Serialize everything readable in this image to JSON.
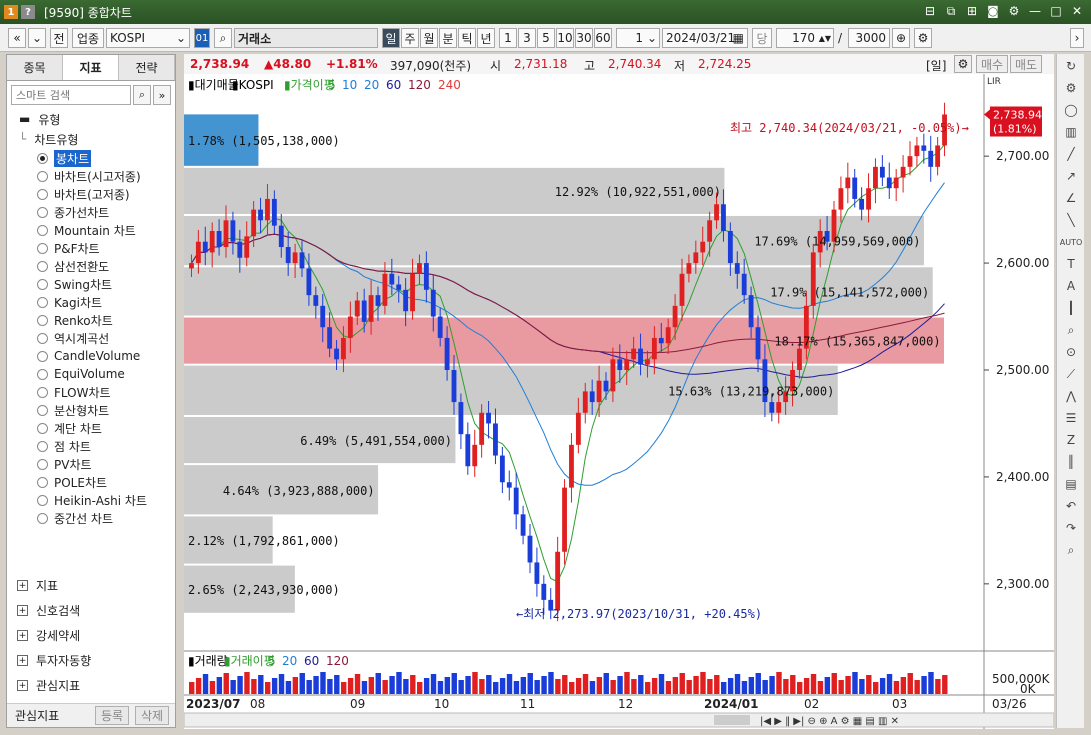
{
  "window": {
    "title": "[9590] 종합차트",
    "icons": [
      "app-icon-1",
      "help-icon"
    ]
  },
  "toolbar": {
    "nav_prev": "«",
    "nav_more": "»",
    "prev_label": "전",
    "sector_label": "업종",
    "symbol": "KOSPI",
    "code_badge": "01",
    "market": "거래소",
    "periods": [
      "일",
      "주",
      "월",
      "분",
      "틱",
      "년"
    ],
    "period_active": "일",
    "minutes": [
      "1",
      "3",
      "5",
      "10",
      "30",
      "60"
    ],
    "interval_value": "1",
    "date": "2024/03/21",
    "cur_label": "당",
    "count": "170",
    "slash": "/",
    "max_count": "3000"
  },
  "quote": {
    "price": "2,738.94",
    "change": "▲48.80",
    "change_pct": "+1.81%",
    "volume": "397,090(천주)",
    "open_label": "시",
    "open": "2,731.18",
    "high_label": "고",
    "high": "2,740.34",
    "low_label": "저",
    "low": "2,724.25",
    "period_badge": "[일]",
    "buy_label": "매수",
    "sell_label": "매도"
  },
  "left_panel": {
    "tabs": [
      "종목",
      "지표",
      "전략"
    ],
    "active_tab": "지표",
    "search_placeholder": "스마트 검색",
    "group_type": "유형",
    "chart_type_header": "차트유형",
    "chart_types": [
      "봉차트",
      "바차트(시고저종)",
      "바차트(고저종)",
      "종가선차트",
      "Mountain 차트",
      "P&F차트",
      "삼선전환도",
      "Swing차트",
      "Kagi차트",
      "Renko차트",
      "역시계곡선",
      "CandleVolume",
      "EquiVolume",
      "FLOW차트",
      "분산형차트",
      "계단 차트",
      "점 차트",
      "PV차트",
      "POLE차트",
      "Heikin-Ashi 차트",
      "중간선 차트"
    ],
    "selected_type": "봉차트",
    "groups": [
      "지표",
      "신호검색",
      "강세약세",
      "투자자동향",
      "관심지표"
    ],
    "favorites_label": "관심지표",
    "register_label": "등록",
    "delete_label": "삭제"
  },
  "chart_data": {
    "type": "candlestick",
    "legend": [
      "대기매물",
      "KOSPI",
      "가격이평",
      "5",
      "10",
      "20",
      "60",
      "120",
      "240"
    ],
    "legend_colors": [
      "#000000",
      "#000000",
      "#2e9e2e",
      "#2e9e2e",
      "#1f7ed8",
      "#1f7ed8",
      "#1a1a9e",
      "#8b1a3a",
      "#e03c3c"
    ],
    "ylim": [
      2240,
      2760
    ],
    "yticks": [
      "2,700.00",
      "2,600.00",
      "2,500.00",
      "2,400.00",
      "2,300.00"
    ],
    "ytick_values": [
      2700,
      2600,
      2500,
      2400,
      2300
    ],
    "xticks": [
      "2023/07",
      "08",
      "09",
      "10",
      "11",
      "12",
      "2024/01",
      "02",
      "03"
    ],
    "last_price_label": "2,738.94",
    "last_pct_label": "(1.81%)",
    "high_annotation": "최고 2,740.34(2024/03/21, -0.05%)→",
    "low_annotation": "←최저 2,273.97(2023/10/31, +20.45%)",
    "volume_profile": [
      {
        "label": "1.78% (1,505,138,000)",
        "low": 2690,
        "high": 2740,
        "pct": 1.78,
        "color": "#3a8ed0"
      },
      {
        "label": "12.92% (10,922,551,000)",
        "low": 2645,
        "high": 2690,
        "pct": 12.92,
        "color": "#c8c8c8"
      },
      {
        "label": "17.69% (14,959,569,000)",
        "low": 2597,
        "high": 2645,
        "pct": 17.69,
        "color": "#c8c8c8"
      },
      {
        "label": "17.9% (15,141,572,000)",
        "low": 2550,
        "high": 2597,
        "pct": 17.9,
        "color": "#c8c8c8"
      },
      {
        "label": "18.17% (15,365,847,000)",
        "low": 2505,
        "high": 2550,
        "pct": 18.17,
        "color": "#e8959c"
      },
      {
        "label": "15.63% (13,219,873,000)",
        "low": 2457,
        "high": 2505,
        "pct": 15.63,
        "color": "#c8c8c8"
      },
      {
        "label": "6.49% (5,491,554,000)",
        "low": 2412,
        "high": 2457,
        "pct": 6.49,
        "color": "#c8c8c8"
      },
      {
        "label": "4.64% (3,923,888,000)",
        "low": 2364,
        "high": 2412,
        "pct": 4.64,
        "color": "#c8c8c8"
      },
      {
        "label": "2.12% (1,792,861,000)",
        "low": 2318,
        "high": 2364,
        "pct": 2.12,
        "color": "#c8c8c8"
      },
      {
        "label": "2.65% (2,243,930,000)",
        "low": 2272,
        "high": 2318,
        "pct": 2.65,
        "color": "#c8c8c8"
      }
    ],
    "closes": [
      2600,
      2620,
      2610,
      2630,
      2615,
      2640,
      2620,
      2605,
      2625,
      2650,
      2640,
      2660,
      2635,
      2615,
      2600,
      2610,
      2595,
      2570,
      2560,
      2540,
      2520,
      2510,
      2530,
      2550,
      2565,
      2545,
      2570,
      2560,
      2590,
      2580,
      2575,
      2555,
      2590,
      2600,
      2575,
      2550,
      2530,
      2500,
      2470,
      2440,
      2410,
      2430,
      2460,
      2450,
      2420,
      2395,
      2390,
      2365,
      2345,
      2320,
      2300,
      2285,
      2275,
      2330,
      2390,
      2430,
      2460,
      2480,
      2470,
      2490,
      2480,
      2510,
      2500,
      2510,
      2520,
      2505,
      2510,
      2530,
      2525,
      2540,
      2560,
      2590,
      2600,
      2610,
      2620,
      2640,
      2655,
      2630,
      2600,
      2590,
      2570,
      2540,
      2510,
      2470,
      2460,
      2470,
      2480,
      2500,
      2520,
      2560,
      2610,
      2630,
      2620,
      2650,
      2670,
      2680,
      2660,
      2650,
      2670,
      2690,
      2680,
      2670,
      2680,
      2690,
      2700,
      2710,
      2705,
      2690,
      2710,
      2739
    ],
    "ma_labels": [
      "5",
      "20",
      "60",
      "120"
    ],
    "volume_legend": [
      "거래량",
      "거래이평",
      "5",
      "20",
      "60",
      "120"
    ],
    "volume_legend_colors": [
      "#000000",
      "#2e9e2e",
      "#2e9e2e",
      "#1f7ed8",
      "#1a1a9e",
      "#8b1a3a"
    ],
    "volume_yticks": [
      "500,000K",
      "0K"
    ],
    "end_date": "03/26"
  }
}
